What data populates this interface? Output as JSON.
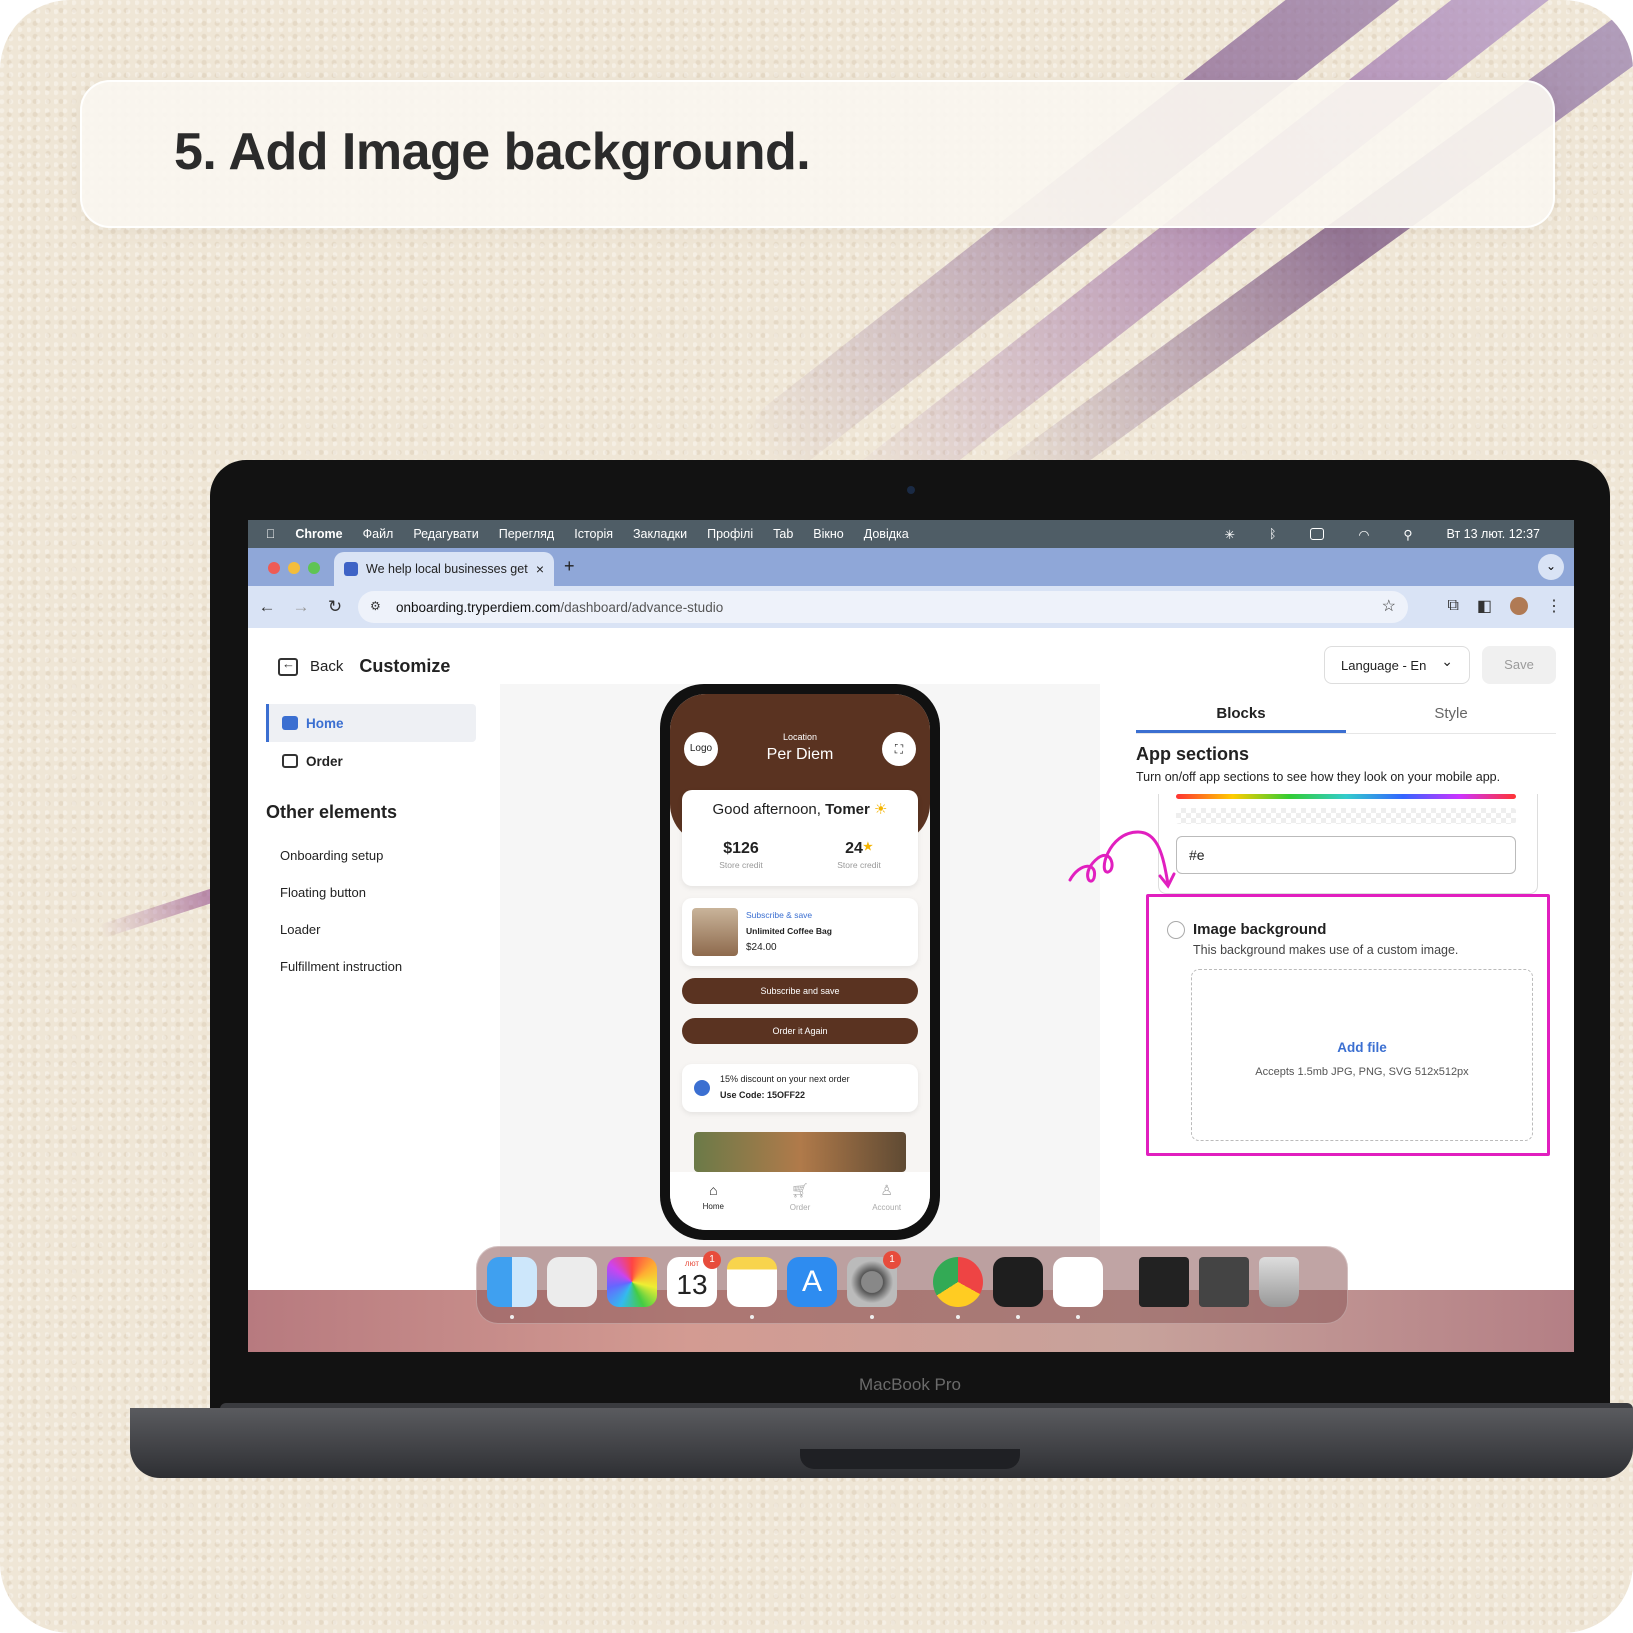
{
  "slide": {
    "title": "5. Add Image background."
  },
  "laptop": {
    "label": "MacBook Pro"
  },
  "menubar": {
    "items": [
      "Chrome",
      "Файл",
      "Редагувати",
      "Перегляд",
      "Історія",
      "Закладки",
      "Профілі",
      "Tab",
      "Вікно",
      "Довідка"
    ],
    "datetime": "Вт 13 лют.  12:37"
  },
  "browser": {
    "tab_title": "We help local businesses get",
    "tab_close": "×",
    "new_tab": "+",
    "url_domain": "onboarding.tryperdiem.com",
    "url_path": "/dashboard/advance-studio"
  },
  "app": {
    "back_label": "Back",
    "page_title": "Customize",
    "language_label": "Language - En",
    "save_label": "Save",
    "sidebar": {
      "items": [
        {
          "label": "Home",
          "active": true,
          "icon": "home-icon"
        },
        {
          "label": "Order",
          "active": false,
          "icon": "cart-icon"
        }
      ],
      "other_title": "Other elements",
      "other_items": [
        "Onboarding setup",
        "Floating button",
        "Loader",
        "Fulfillment instruction"
      ]
    },
    "panel": {
      "tabs": [
        "Blocks",
        "Style"
      ],
      "active_tab": "Blocks",
      "heading": "App sections",
      "subheading": "Turn on/off app sections to see how they look on your mobile app.",
      "hex_value": "#e",
      "image_background": {
        "title": "Image background",
        "description": "This background makes use of a custom image.",
        "add_file": "Add file",
        "accepts": "Accepts 1.5mb JPG, PNG, SVG 512x512px"
      }
    },
    "phone": {
      "logo": "Logo",
      "location_label": "Location",
      "location_value": "Per Diem",
      "greeting": "Good afternoon, ",
      "greeting_name": "Tomer",
      "credit_value": "$126",
      "credit_label": "Store credit",
      "points_value": "24",
      "points_label": "Store credit",
      "subscribe_tag": "Subscribe & save",
      "product_name": "Unlimited Coffee Bag",
      "product_price": "$24.00",
      "btn_subscribe": "Subscribe and save",
      "btn_order_again": "Order it Again",
      "discount_text": "15% discount on your next order",
      "discount_code": "Use Code: 15OFF22",
      "nav": [
        "Home",
        "Order",
        "Account"
      ]
    }
  },
  "dock": {
    "calendar_month": "лют",
    "calendar_day": "13",
    "calendar_badge": "1",
    "settings_badge": "1"
  },
  "colors": {
    "accent": "#3b6fd1",
    "brand_brown": "#5a3321",
    "highlight": "#e11fbf"
  }
}
